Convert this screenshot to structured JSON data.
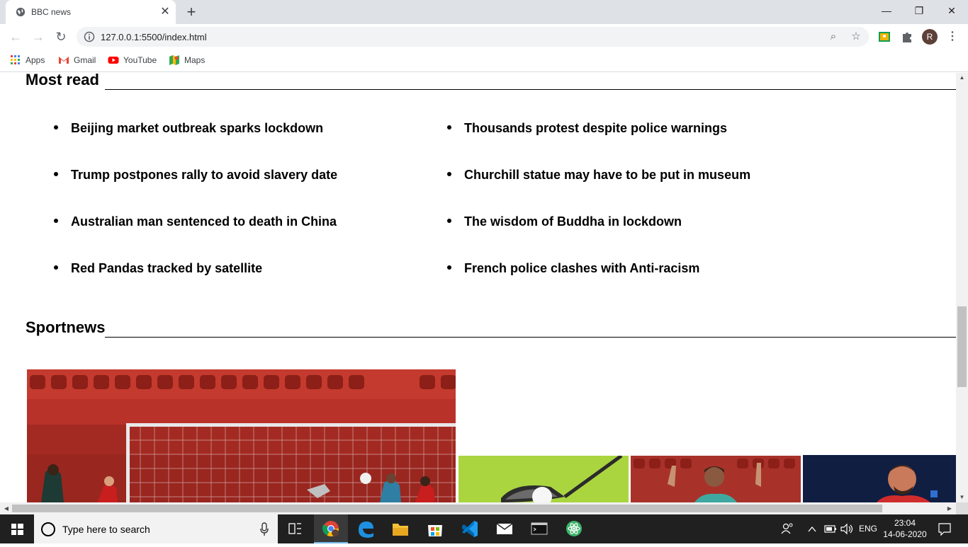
{
  "browser": {
    "tab_title": "BBC news",
    "url": "127.0.0.1:5500/index.html",
    "profile_initial": "R",
    "bookmarks": [
      {
        "label": "Apps",
        "icon": "apps-grid-icon"
      },
      {
        "label": "Gmail",
        "icon": "gmail-icon"
      },
      {
        "label": "YouTube",
        "icon": "youtube-icon"
      },
      {
        "label": "Maps",
        "icon": "maps-icon"
      }
    ]
  },
  "page": {
    "most_read": {
      "title": "Most read",
      "left_items": [
        "Beijing market outbreak sparks lockdown",
        "Trump postpones rally to avoid slavery date",
        "Australian man sentenced to death in China",
        "Red Pandas tracked by satellite"
      ],
      "right_items": [
        "Thousands protest despite police warnings",
        "Churchill statue may have to be put in museum",
        "The wisdom of Buddha in lockdown",
        "French police clashes with Anti-racism"
      ]
    },
    "sportnews": {
      "title": "Sportnews",
      "images": [
        {
          "name": "football-goal-photo"
        },
        {
          "name": "golf-club-photo"
        },
        {
          "name": "messi-celebration-photo"
        },
        {
          "name": "goalkeeper-photo"
        }
      ]
    }
  },
  "taskbar": {
    "search_placeholder": "Type here to search",
    "language": "ENG",
    "time": "23:04",
    "date": "14-06-2020"
  }
}
